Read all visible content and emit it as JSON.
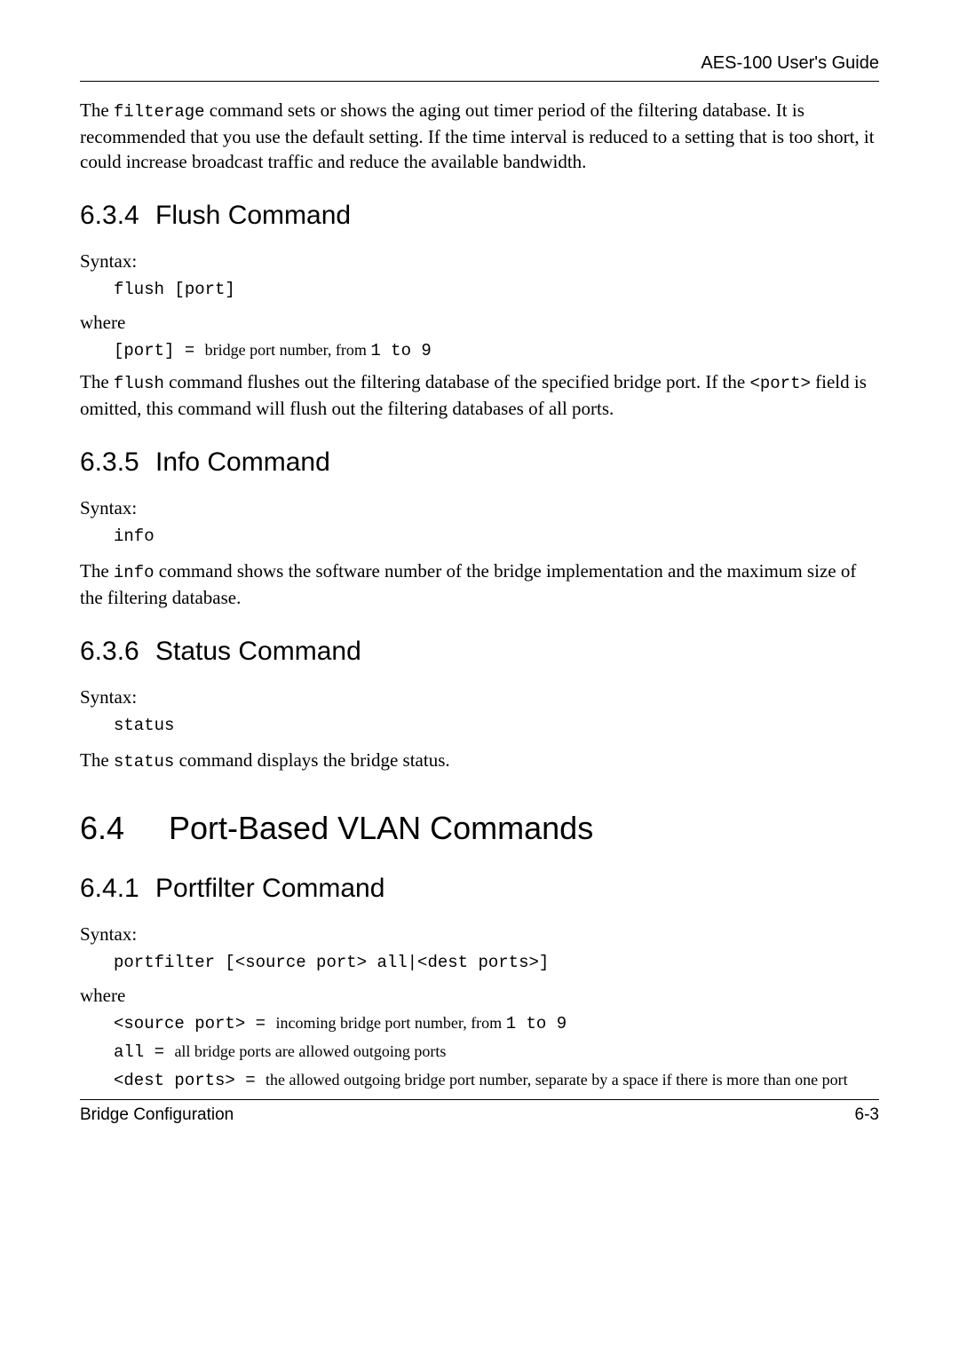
{
  "header": {
    "title": "AES-100 User's Guide"
  },
  "intro": {
    "text1": "The ",
    "code1": "filterage",
    "text2": " command sets or shows the aging out timer period of the filtering database. It is recommended that you use the default setting. If the time interval is reduced to a setting that is too short, it could increase broadcast traffic and reduce the available bandwidth."
  },
  "s634": {
    "num": "6.3.4",
    "title": "Flush Command",
    "syntax_label": "Syntax:",
    "code": "flush [port]",
    "where_label": "where",
    "def_code": "[port]",
    "def_eq": " = ",
    "def_text1": "bridge port number, from ",
    "def_range": "1 to 9",
    "body1a": "The ",
    "body1b": "flush",
    "body1c": " command flushes out the filtering database of the specified bridge port. If the ",
    "body1d": "<port>",
    "body1e": " field is omitted, this command will flush out the filtering databases of all ports."
  },
  "s635": {
    "num": "6.3.5",
    "title": "Info Command",
    "syntax_label": "Syntax:",
    "code": "info",
    "body1a": "The ",
    "body1b": "info",
    "body1c": " command shows the software number of the bridge implementation and the maximum size of the filtering database."
  },
  "s636": {
    "num": "6.3.6",
    "title": "Status Command",
    "syntax_label": "Syntax:",
    "code": "status",
    "body1a": "The ",
    "body1b": "status",
    "body1c": " command displays the bridge status."
  },
  "s64": {
    "num": "6.4",
    "title": "Port-Based VLAN Commands"
  },
  "s641": {
    "num": "6.4.1",
    "title": "Portfilter Command",
    "syntax_label": "Syntax:",
    "code": "portfilter [<source port> all|<dest ports>]",
    "where_label": "where",
    "def1_code": "<source port>",
    "def1_eq": " = ",
    "def1_text": "incoming bridge port number, from ",
    "def1_range": "1 to 9",
    "def2_code": "all",
    "def2_eq": " = ",
    "def2_text": "all bridge ports are allowed outgoing ports",
    "def3_code": "<dest ports>",
    "def3_eq": " = ",
    "def3_text": "the allowed outgoing bridge port number, separate by a space if there is more than one port"
  },
  "footer": {
    "left": "Bridge Configuration",
    "right": "6-3"
  }
}
